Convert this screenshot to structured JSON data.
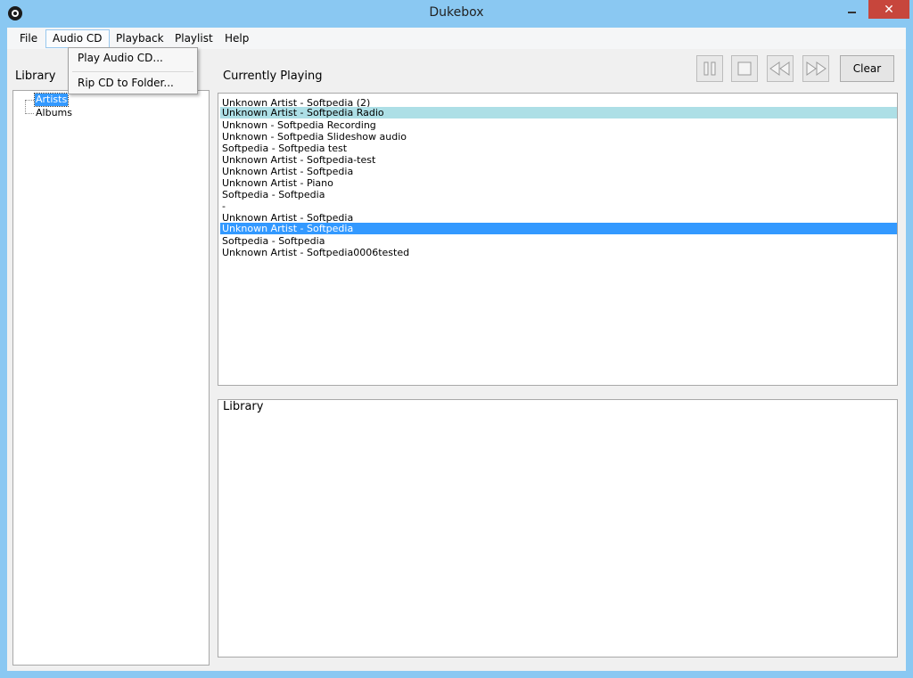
{
  "window": {
    "title": "Dukebox"
  },
  "menu": {
    "items": [
      "File",
      "Audio CD",
      "Playback",
      "Playlist",
      "Help"
    ],
    "open_menu": "Audio CD",
    "dropdown": [
      "Play Audio CD...",
      "Rip CD to Folder..."
    ]
  },
  "library": {
    "label": "Library",
    "tree": [
      "Artists",
      "Albums"
    ],
    "selected": "Artists"
  },
  "now_playing": {
    "label": "Currently Playing",
    "rows": [
      "Unknown Artist - Softpedia (2)",
      "Unknown Artist - Softpedia Radio",
      "Unknown - Softpedia Recording",
      "Unknown - Softpedia Slideshow audio",
      "Softpedia - Softpedia test",
      "Unknown Artist - Softpedia-test",
      "Unknown Artist - Softpedia",
      "Unknown Artist - Piano",
      "Softpedia - Softpedia",
      " -",
      "Unknown Artist - Softpedia",
      "Unknown Artist - Softpedia",
      "Softpedia - Softpedia",
      "Unknown Artist - Softpedia0006tested"
    ],
    "highlighted_row": "Unknown Artist - Softpedia Radio",
    "selected_row": "Unknown Artist - Softpedia"
  },
  "controls": {
    "icons": [
      "pause-icon",
      "stop-icon",
      "rewind-icon",
      "fast-forward-icon"
    ],
    "clear_label": "Clear"
  },
  "library_panel": {
    "label": "Library"
  },
  "colors": {
    "titlebar": "#8ac8f2",
    "selection": "#3399ff",
    "highlight": "#addfe6",
    "close": "#c7463c"
  }
}
